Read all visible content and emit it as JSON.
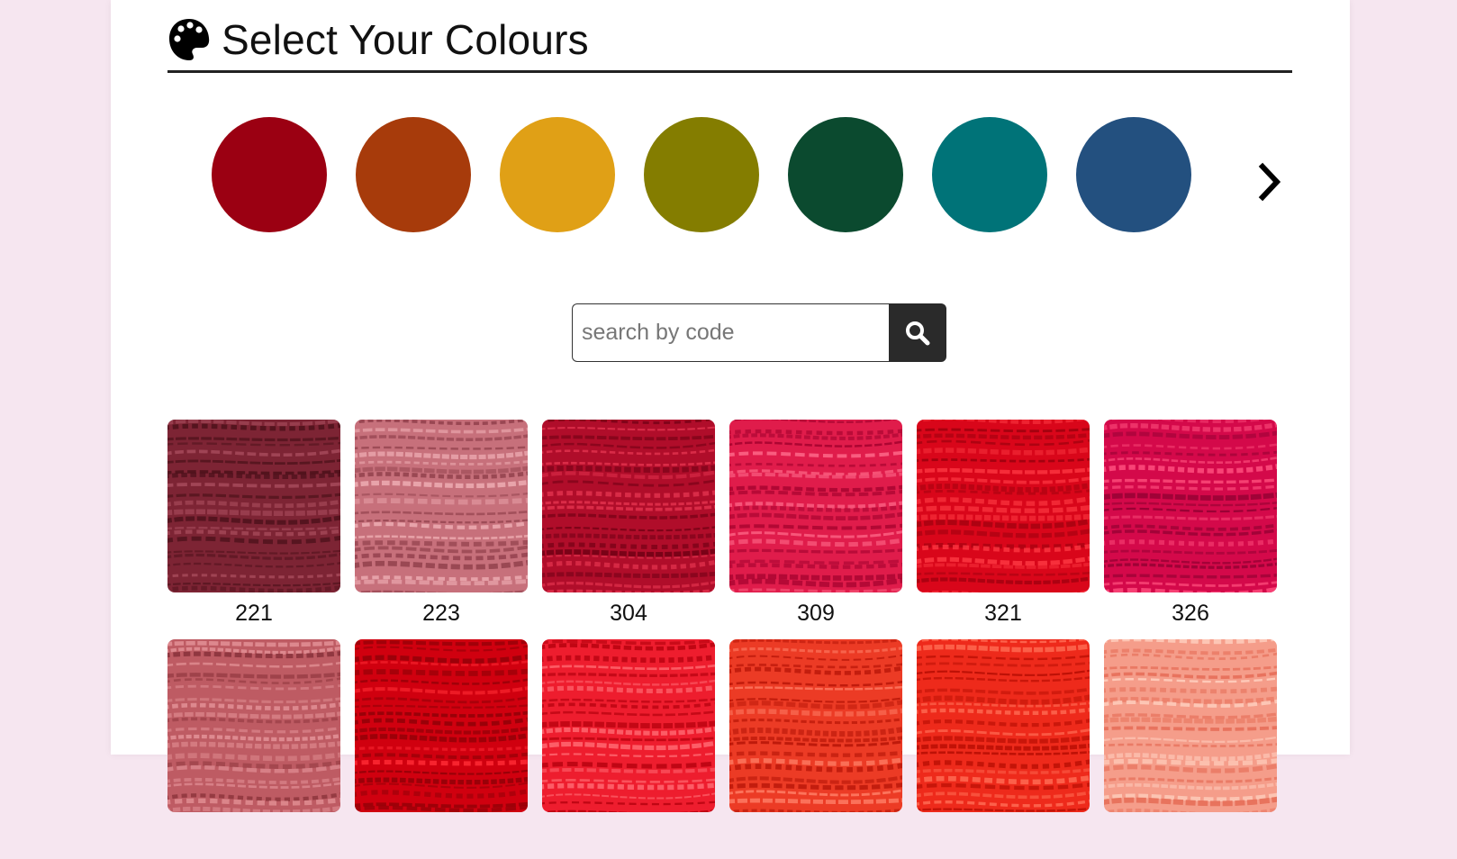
{
  "header": {
    "title": "Select Your Colours",
    "icon": "palette-icon"
  },
  "swatches": [
    {
      "name": "red",
      "color": "#9b0012"
    },
    {
      "name": "orange",
      "color": "#a73b0b"
    },
    {
      "name": "yellow",
      "color": "#e0a016"
    },
    {
      "name": "olive",
      "color": "#847d00"
    },
    {
      "name": "dark-green",
      "color": "#0b4a2f"
    },
    {
      "name": "teal",
      "color": "#007378"
    },
    {
      "name": "blue",
      "color": "#23507f"
    }
  ],
  "next_icon": "chevron-right-icon",
  "search": {
    "placeholder": "search by code",
    "value": "",
    "icon": "search-icon"
  },
  "threads": [
    {
      "code": "221",
      "base": "#7d2434",
      "light": "#b25566",
      "dark": "#4a1019"
    },
    {
      "code": "223",
      "base": "#c7707b",
      "light": "#efaeb4",
      "dark": "#8f3e4a"
    },
    {
      "code": "304",
      "base": "#b00d2a",
      "light": "#e53450",
      "dark": "#700014"
    },
    {
      "code": "309",
      "base": "#e01c4b",
      "light": "#ff6b8b",
      "dark": "#a0002c"
    },
    {
      "code": "321",
      "base": "#d9061a",
      "light": "#ff3a44",
      "dark": "#98000d"
    },
    {
      "code": "326",
      "base": "#d4094a",
      "light": "#ff4f7e",
      "dark": "#8c0030"
    },
    {
      "code": "",
      "base": "#be5b63",
      "light": "#e59499",
      "dark": "#873038"
    },
    {
      "code": "",
      "base": "#d0000f",
      "light": "#ff2a35",
      "dark": "#8e0007"
    },
    {
      "code": "",
      "base": "#ee1d2e",
      "light": "#ff6a72",
      "dark": "#b3000d"
    },
    {
      "code": "",
      "base": "#ec3b25",
      "light": "#ff8068",
      "dark": "#b31205"
    },
    {
      "code": "",
      "base": "#ee2a1b",
      "light": "#ff6d55",
      "dark": "#b10a00"
    },
    {
      "code": "",
      "base": "#f59d8a",
      "light": "#ffd2c2",
      "dark": "#e56b55"
    }
  ]
}
